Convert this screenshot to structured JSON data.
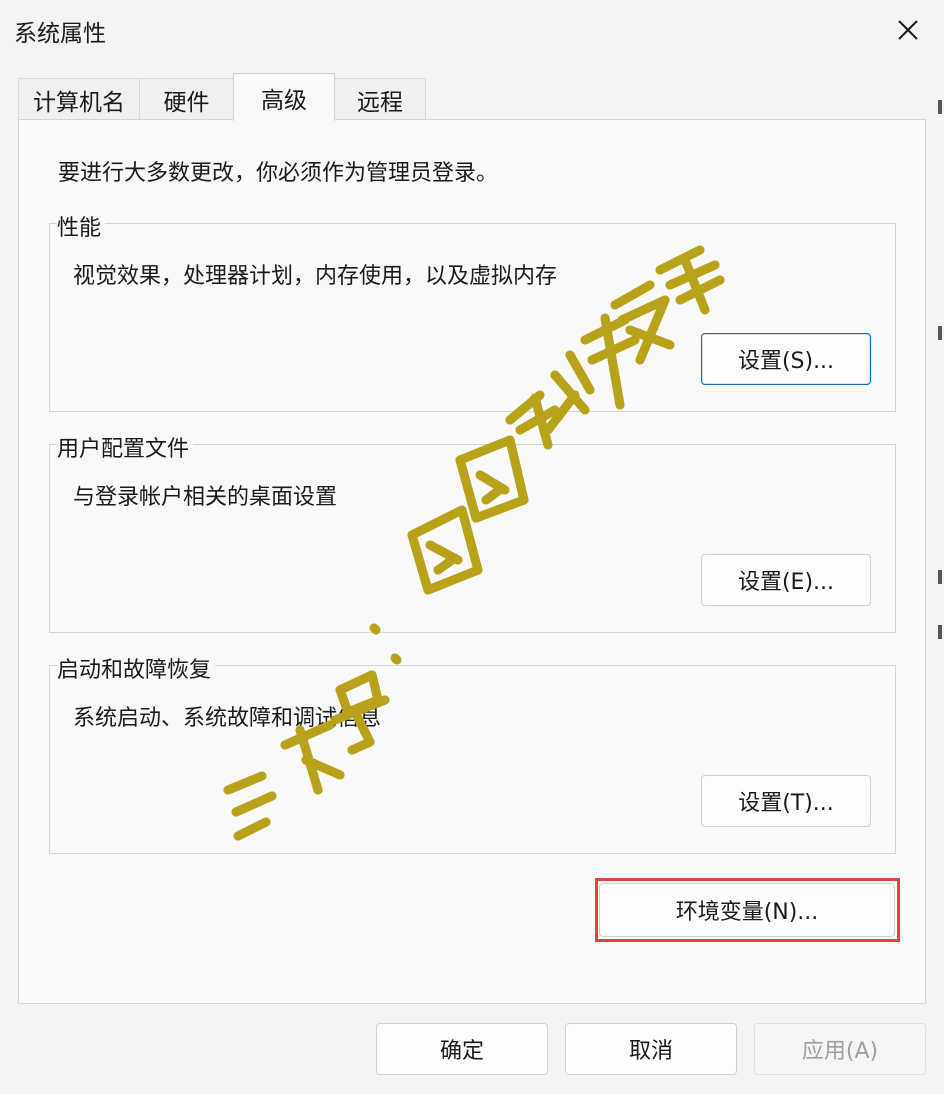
{
  "window": {
    "title": "系统属性",
    "close_glyph": "✕"
  },
  "tabs": [
    {
      "label": "计算机名",
      "active": false
    },
    {
      "label": "硬件",
      "active": false
    },
    {
      "label": "高级",
      "active": true
    },
    {
      "label": "远程",
      "active": false
    }
  ],
  "advanced": {
    "admin_note": "要进行大多数更改，你必须作为管理员登录。",
    "groups": [
      {
        "title": "性能",
        "description": "视觉效果，处理器计划，内存使用，以及虚拟内存",
        "button": "设置(S)..."
      },
      {
        "title": "用户配置文件",
        "description": "与登录帐户相关的桌面设置",
        "button": "设置(E)..."
      },
      {
        "title": "启动和故障恢复",
        "description": "系统启动、系统故障和调试信息",
        "button": "设置(T)..."
      }
    ],
    "env_button": "环境变量(N)..."
  },
  "footer": {
    "ok": "确定",
    "cancel": "取消",
    "apply": "应用(A)"
  },
  "watermark": {
    "text": "公众号：图图软件安装",
    "color": "#f2e34a",
    "outline": "#b8a21a"
  },
  "highlight_color": "#e04545"
}
